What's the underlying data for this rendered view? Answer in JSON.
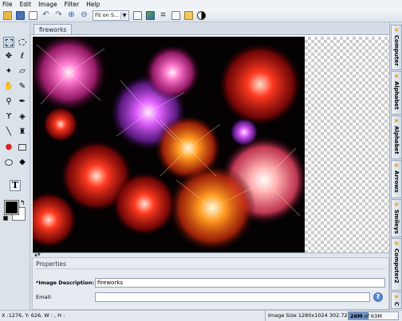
{
  "menu": [
    "File",
    "Edit",
    "Image",
    "Filter",
    "Help"
  ],
  "toolbar": {
    "zoom_select": "Fit on S...",
    "buttons": [
      "open-folder-icon",
      "save-icon",
      "new-document-icon",
      "undo-icon",
      "redo-icon",
      "zoom-in-icon",
      "zoom-out-icon",
      "image-icon",
      "resize-icon",
      "crop-icon",
      "copy-icon",
      "paste-icon",
      "contrast-icon"
    ]
  },
  "document": {
    "tab_title": "fireworks"
  },
  "tools": {
    "text_tool_label": "T",
    "foreground_color": "#000000",
    "background_color": "#ffffff"
  },
  "right_tabs": [
    "Computer",
    "Alphabet",
    "Alphabet",
    "Arrows",
    "Smileys",
    "Computer2",
    "C"
  ],
  "properties": {
    "title": "Properties",
    "image_description_label": "*Image Description:",
    "image_description_value": "fireworks",
    "email_label": "Email:",
    "email_value": "",
    "help_label": "?"
  },
  "status": {
    "coords": "X :1276, Y: 626, W : , H :",
    "image_size": "Image Size 1280x1024",
    "file_size": "302.72K",
    "memory_used": "26M",
    "memory_total": "of 63M",
    "memory_fraction": 0.41
  },
  "colors": {
    "accent": "#6f91c4",
    "star": "#e8a020"
  }
}
